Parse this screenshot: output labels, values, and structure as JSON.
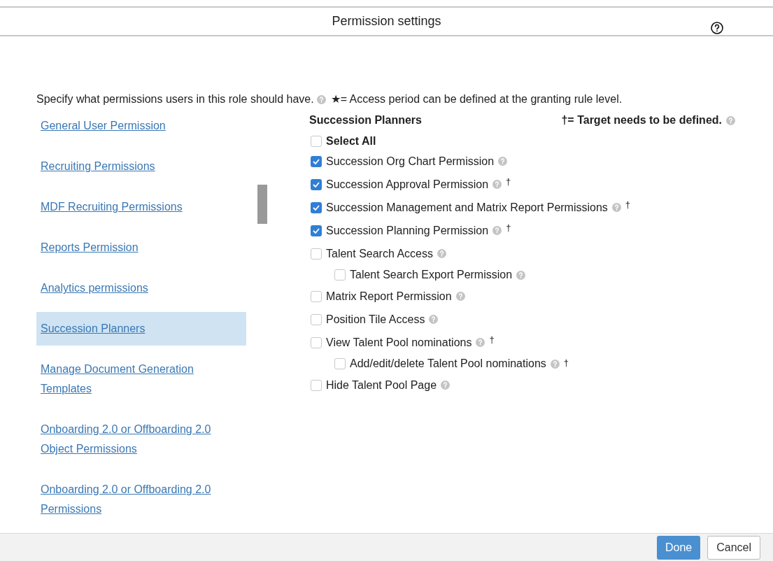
{
  "dialog": {
    "title": "Permission settings"
  },
  "intro": {
    "text": "Specify what permissions users in this role should have.",
    "star_note": "★= Access period can be defined at the granting rule level."
  },
  "nav": [
    {
      "label": "General User Permission",
      "selected": false
    },
    {
      "label": "Recruiting Permissions",
      "selected": false
    },
    {
      "label": "MDF Recruiting Permissions",
      "selected": false
    },
    {
      "label": "Reports Permission",
      "selected": false
    },
    {
      "label": "Analytics permissions",
      "selected": false
    },
    {
      "label": "Succession Planners",
      "selected": true
    },
    {
      "label": "Manage Document Generation Templates",
      "selected": false
    },
    {
      "label": "Onboarding 2.0 or Offboarding 2.0 Object Permissions",
      "selected": false
    },
    {
      "label": "Onboarding 2.0 or Offboarding 2.0 Permissions",
      "selected": false
    }
  ],
  "panel": {
    "title": "Succession Planners",
    "target_note": "†= Target needs to be defined.",
    "select_all": {
      "label": "Select All",
      "checked": false
    },
    "permissions": [
      {
        "label": "Succession Org Chart Permission",
        "checked": true
      },
      {
        "label": "Succession Approval Permission",
        "checked": true,
        "mark": "†"
      },
      {
        "label": "Succession Management and Matrix Report Permissions",
        "checked": true,
        "mark": "†"
      },
      {
        "label": "Succession Planning Permission",
        "checked": true,
        "mark": "†"
      },
      {
        "label": "Talent Search Access",
        "checked": false,
        "children": [
          {
            "label": "Talent Search Export Permission",
            "checked": false
          }
        ]
      },
      {
        "label": "Matrix Report Permission",
        "checked": false
      },
      {
        "label": "Position Tile Access",
        "checked": false
      },
      {
        "label": "View Talent Pool nominations",
        "checked": false,
        "mark": "†",
        "children": [
          {
            "label": "Add/edit/delete Talent Pool nominations",
            "checked": false,
            "mark": "†"
          }
        ]
      },
      {
        "label": "Hide Talent Pool Page",
        "checked": false
      }
    ]
  },
  "buttons": [
    {
      "label": "Done",
      "kind": "primary"
    },
    {
      "label": "Cancel",
      "kind": "secondary"
    }
  ]
}
